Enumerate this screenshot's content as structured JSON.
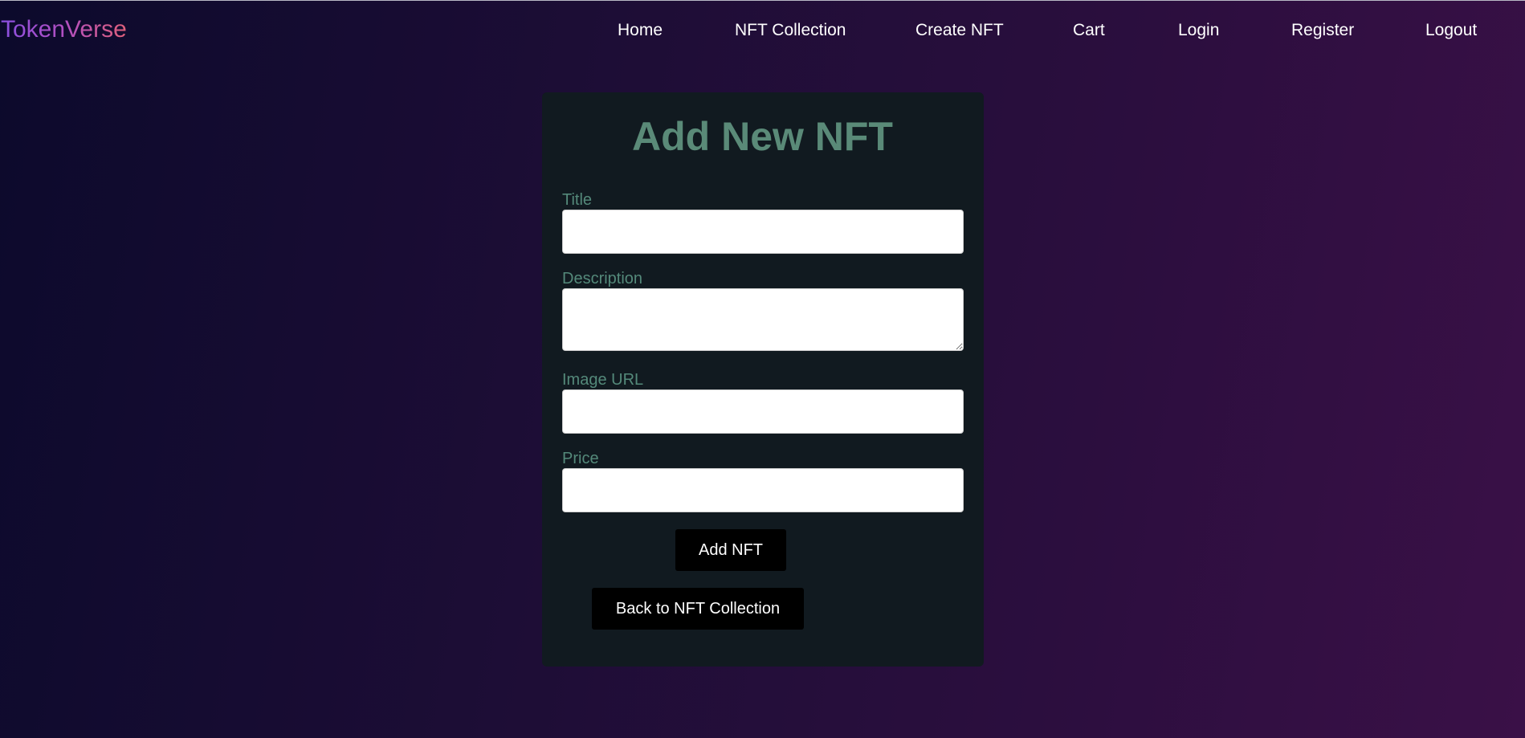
{
  "brand": "TokenVerse",
  "nav": {
    "home": "Home",
    "collection": "NFT Collection",
    "create": "Create NFT",
    "cart": "Cart",
    "login": "Login",
    "register": "Register",
    "logout": "Logout"
  },
  "form": {
    "heading": "Add New NFT",
    "title_label": "Title",
    "title_value": "",
    "description_label": "Description",
    "description_value": "",
    "image_label": "Image URL",
    "image_value": "",
    "price_label": "Price",
    "price_value": "",
    "submit_label": "Add NFT",
    "back_label": "Back to NFT Collection"
  },
  "colors": {
    "accent_label": "#54897a",
    "card_bg": "#111a20",
    "button_bg": "#000000",
    "brand_gradient_start": "#8a4fe0",
    "brand_gradient_end": "#e0607a"
  }
}
